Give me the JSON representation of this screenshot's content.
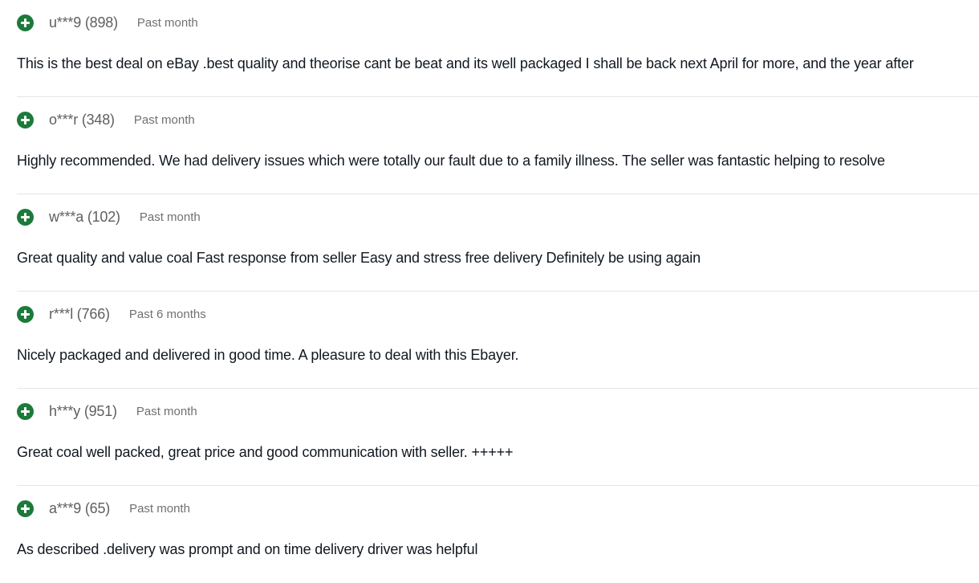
{
  "colors": {
    "positive": "#1c7a3a",
    "text": "#111820",
    "muted": "#707070",
    "divider": "#e5e5e5"
  },
  "feedback": [
    {
      "icon": "positive-feedback-icon",
      "user": "u***9 (898)",
      "period": "Past month",
      "comment": "This is the best deal on eBay .best quality and theorise cant be beat and its well packaged I shall be back next April for more, and the year after"
    },
    {
      "icon": "positive-feedback-icon",
      "user": "o***r (348)",
      "period": "Past month",
      "comment": "Highly recommended. We had delivery issues which were totally our fault due to a family illness. The seller was fantastic helping to resolve"
    },
    {
      "icon": "positive-feedback-icon",
      "user": "w***a (102)",
      "period": "Past month",
      "comment": "Great quality and value coal Fast response from seller Easy and stress free delivery Definitely be using again"
    },
    {
      "icon": "positive-feedback-icon",
      "user": "r***l (766)",
      "period": "Past 6 months",
      "comment": "Nicely packaged and delivered in good time. A pleasure to deal with this Ebayer."
    },
    {
      "icon": "positive-feedback-icon",
      "user": "h***y (951)",
      "period": "Past month",
      "comment": "Great coal well packed, great price and good communication with seller. +++++"
    },
    {
      "icon": "positive-feedback-icon",
      "user": "a***9 (65)",
      "period": "Past month",
      "comment": "As described .delivery was prompt and on time delivery driver was helpful"
    }
  ]
}
